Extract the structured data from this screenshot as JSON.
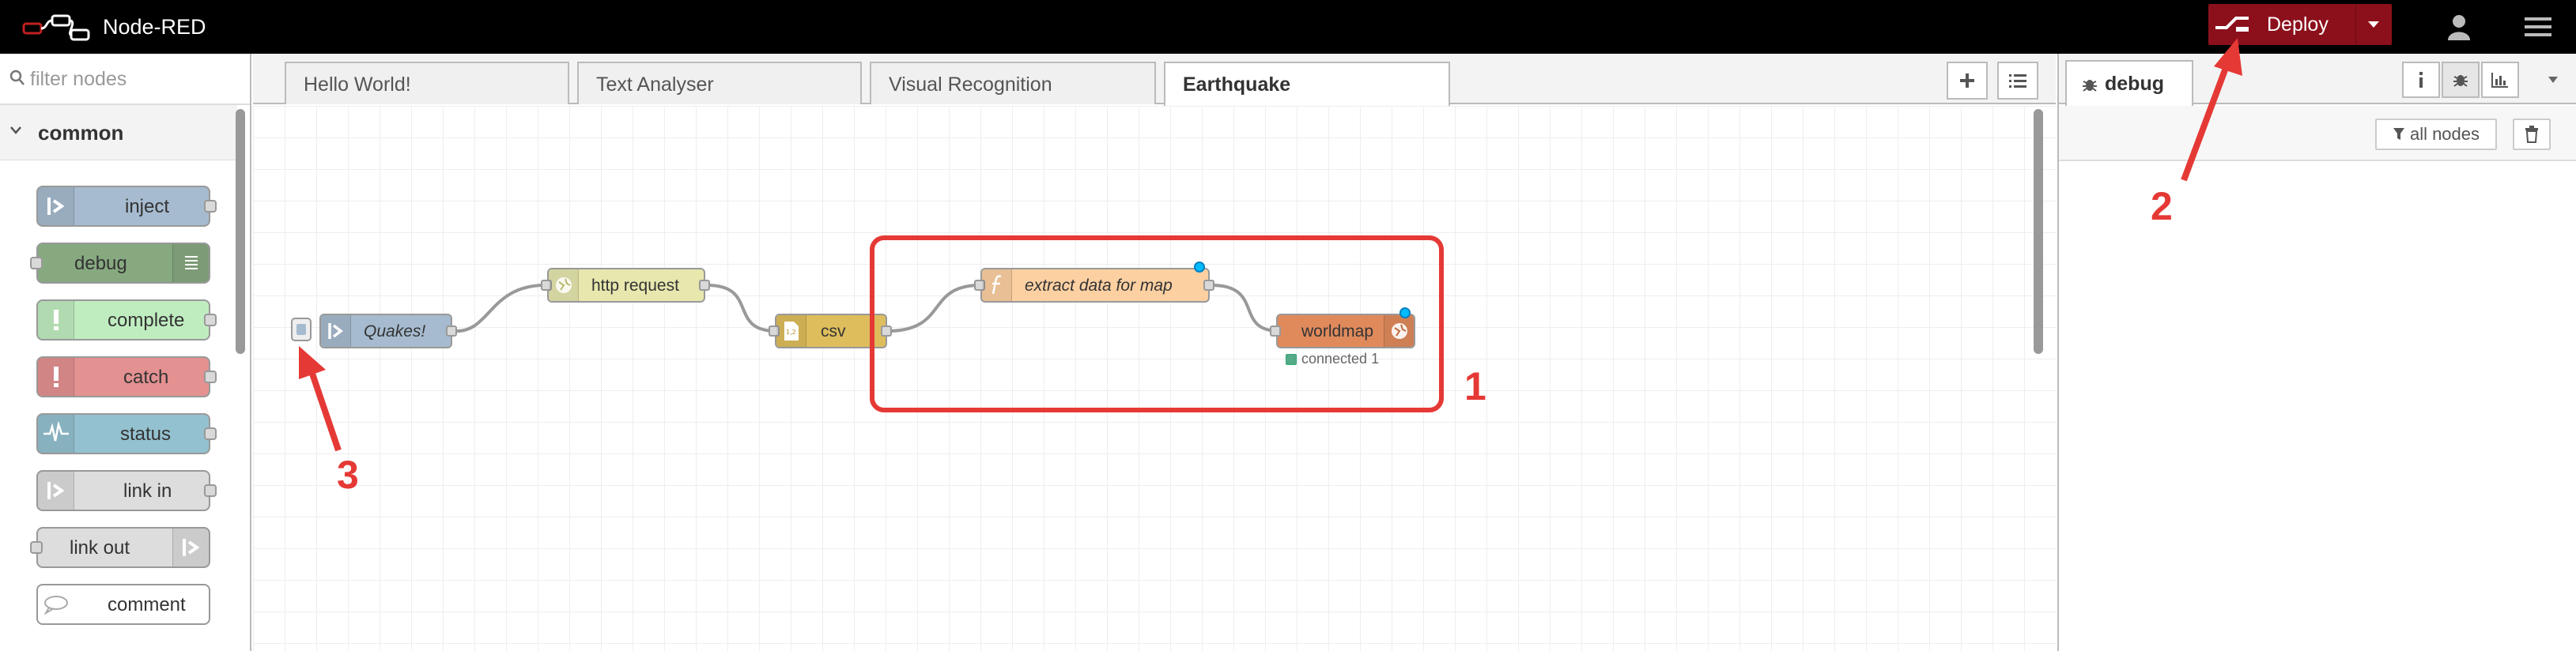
{
  "app": {
    "title": "Node-RED"
  },
  "header": {
    "deploy_label": "Deploy",
    "icons": [
      "node-red-logo",
      "deploy-icon",
      "caret-down-icon",
      "user-icon",
      "hamburger-menu-icon"
    ]
  },
  "palette": {
    "filter_placeholder": "filter nodes",
    "category": "common",
    "nodes": [
      {
        "label": "inject",
        "color": "#a6bbcf",
        "icon": "arrow-in-icon"
      },
      {
        "label": "debug",
        "color": "#87a980",
        "icon": "list-icon"
      },
      {
        "label": "complete",
        "color": "#c0edc0",
        "icon": "exclamation-icon"
      },
      {
        "label": "catch",
        "color": "#e49191",
        "icon": "exclamation-icon"
      },
      {
        "label": "status",
        "color": "#94c1d0",
        "icon": "pulse-icon"
      },
      {
        "label": "link in",
        "color": "#dddddd",
        "icon": "link-icon"
      },
      {
        "label": "link out",
        "color": "#dddddd",
        "icon": "link-icon"
      },
      {
        "label": "comment",
        "color": "#ffffff",
        "icon": "comment-icon"
      }
    ]
  },
  "workspace": {
    "tabs": [
      {
        "label": "Hello World!",
        "active": false
      },
      {
        "label": "Text Analyser",
        "active": false
      },
      {
        "label": "Visual Recognition",
        "active": false
      },
      {
        "label": "Earthquake",
        "active": true
      }
    ],
    "flow": {
      "nodes": [
        {
          "id": "quakes",
          "label": "Quakes!",
          "color": "#a6bbcf"
        },
        {
          "id": "http",
          "label": "http request",
          "color": "#e7e7ae"
        },
        {
          "id": "csv",
          "label": "csv",
          "color": "#debd5c"
        },
        {
          "id": "extract",
          "label": "extract data for map",
          "color": "#fdd0a2"
        },
        {
          "id": "worldmap",
          "label": "worldmap",
          "color": "#e08a5c"
        }
      ],
      "worldmap_status": "connected 1"
    }
  },
  "sidebar": {
    "active_tab": "debug",
    "filter_label": "all nodes"
  },
  "annotations": {
    "box_number": "1",
    "deploy_number": "2",
    "inject_number": "3",
    "color": "#e53935"
  }
}
